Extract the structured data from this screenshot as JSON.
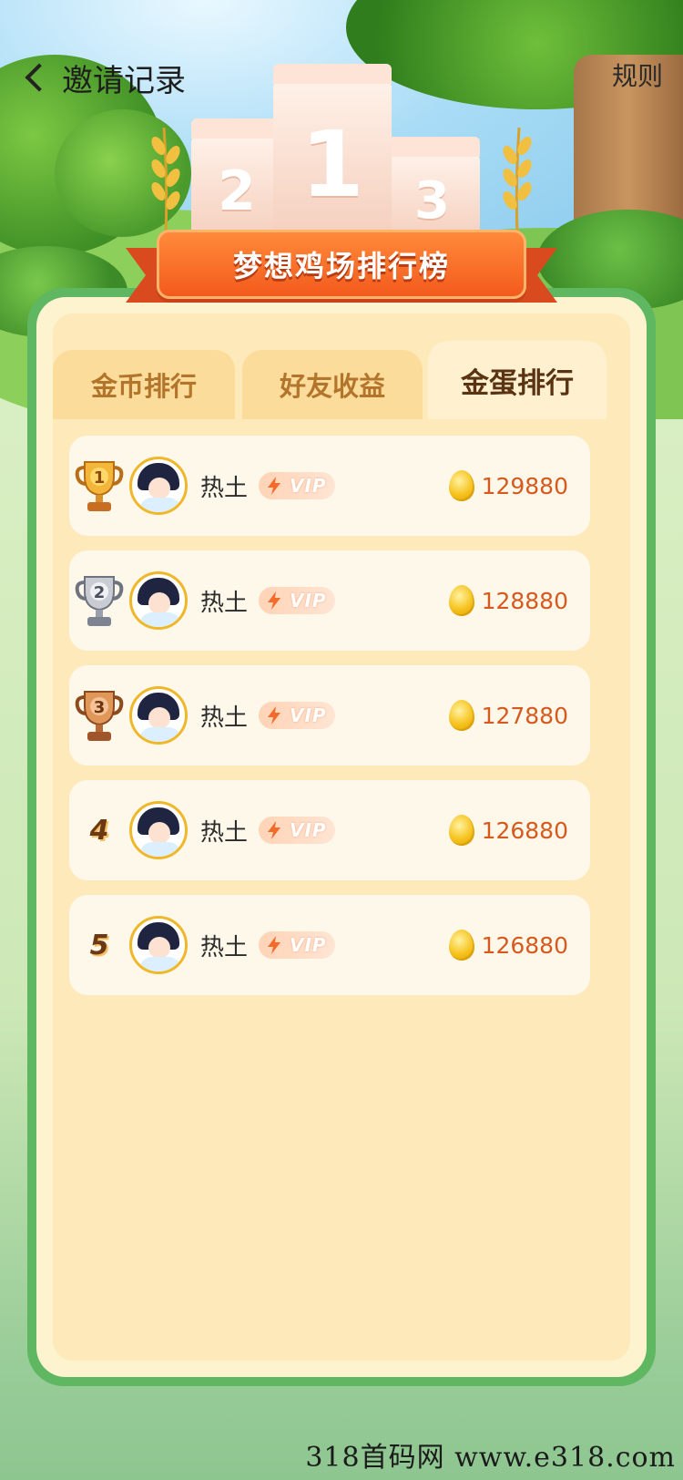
{
  "header": {
    "title": "邀请记录",
    "rules_label": "规则"
  },
  "podium": {
    "first": "1",
    "second": "2",
    "third": "3"
  },
  "banner": {
    "title": "梦想鸡场排行榜"
  },
  "tabs": [
    {
      "label": "金币排行",
      "active": false
    },
    {
      "label": "好友收益",
      "active": false
    },
    {
      "label": "金蛋排行",
      "active": true
    }
  ],
  "leaderboard": [
    {
      "rank": "1",
      "rank_badge": "gold-trophy-icon",
      "name": "热土",
      "vip": "VIP",
      "value": "129880"
    },
    {
      "rank": "2",
      "rank_badge": "silver-trophy-icon",
      "name": "热土",
      "vip": "VIP",
      "value": "128880"
    },
    {
      "rank": "3",
      "rank_badge": "bronze-trophy-icon",
      "name": "热土",
      "vip": "VIP",
      "value": "127880"
    },
    {
      "rank": "4",
      "rank_badge": "",
      "name": "热土",
      "vip": "VIP",
      "value": "126880"
    },
    {
      "rank": "5",
      "rank_badge": "",
      "name": "热土",
      "vip": "VIP",
      "value": "126880"
    }
  ],
  "colors": {
    "frame_green": "#5fb762",
    "banner_orange": "#f35a1d",
    "score_orange": "#d65a1e",
    "tab_active_text": "#5a3412",
    "tab_inactive_text": "#b3742b"
  },
  "watermark": "318首码网  www.e318.com"
}
